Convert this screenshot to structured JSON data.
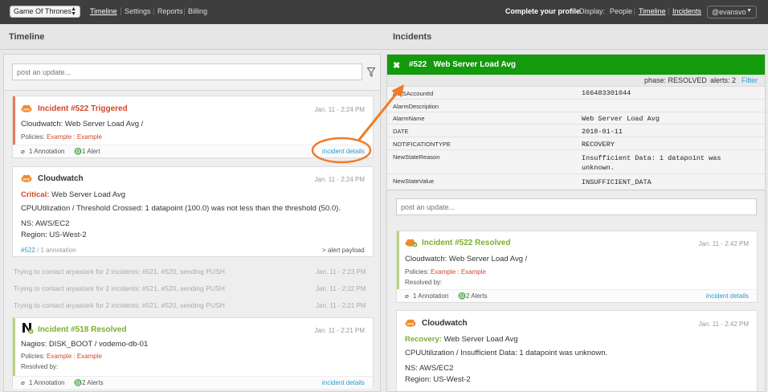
{
  "topbar": {
    "project": "Game Of Thrones",
    "nav": [
      "Timeline",
      "Settings",
      "Reports",
      "Billing"
    ],
    "complete_profile": "Complete your profile",
    "display_label": "Display:",
    "display_options": [
      "People",
      "Timeline",
      "Incidents"
    ],
    "user": "@evansvo"
  },
  "left": {
    "header": "Timeline",
    "post_placeholder": "post an update...",
    "card1": {
      "title": "Incident #522 Triggered",
      "time": "Jan. 11 - 2:24 PM",
      "body": "Cloudwatch: Web Server Load Avg /",
      "policies_label": "Policies:",
      "policies_value": "Example : Example",
      "annotation": "1 Annotation",
      "alerts": "1 Alert",
      "details": "incident details"
    },
    "card2": {
      "title": "Cloudwatch",
      "time": "Jan. 11 - 2:24 PM",
      "critical_label": "Critical:",
      "critical_value": "Web Server Load Avg",
      "desc": "CPUUtilization / Threshold Crossed: 1 datapoint (100.0) was not less than the threshold (50.0).",
      "ns": "NS: AWS/EC2",
      "region": "Region: US-West-2",
      "link": "#522",
      "annotation": "/ 1 annotation",
      "payload": "> alert payload"
    },
    "logs": [
      {
        "text": "Trying to contact aryastark for 2 incidents: #521, #520, sending PUSH",
        "time": "Jan. 11 - 2:23 PM"
      },
      {
        "text": "Trying to contact aryastark for 2 incidents: #521, #520, sending PUSH",
        "time": "Jan. 11 - 2:22 PM"
      },
      {
        "text": "Trying to contact aryastark for 2 incidents: #521, #520, sending PUSH",
        "time": "Jan. 11 - 2:21 PM"
      }
    ],
    "card3": {
      "title": "Incident #518 Resolved",
      "time": "Jan. 11 - 2:21 PM",
      "body": "Nagios: DISK_BOOT / vodemo-db-01",
      "policies_label": "Policies:",
      "policies_value": "Example : Example",
      "resolved_by": "Resolved by:",
      "annotation": "1 Annotation",
      "alerts": "2 Alerts",
      "details": "incident details"
    }
  },
  "right": {
    "header": "Incidents",
    "incident_title": "#522   Web Server Load Avg",
    "phase": "phase: RESOLVED",
    "alerts": "alerts: 2",
    "filter": "Filter",
    "fields": [
      {
        "key": "AWSAccountId",
        "value": "166483301044"
      },
      {
        "key": "AlarmDescription",
        "value": ""
      },
      {
        "key": "AlarmName",
        "value": "Web Server Load Avg"
      },
      {
        "key": "DATE",
        "value": "2018-01-11"
      },
      {
        "key": "NOTIFICATIONTYPE",
        "value": "RECOVERY"
      },
      {
        "key": "NewStateReason",
        "value": "Insufficient Data: 1 datapoint was"
      },
      {
        "key": "NewStateValue",
        "value": "INSUFFICIENT_DATA"
      }
    ],
    "reason_cont": "unknown.",
    "post_placeholder": "post an update...",
    "card1": {
      "title": "Incident #522 Resolved",
      "time": "Jan. 11 - 2:42 PM",
      "body": "Cloudwatch: Web Server Load Avg /",
      "policies_label": "Policies:",
      "policies_value": "Example : Example",
      "resolved_by": "Resolved by:",
      "annotation": "1 Annotation",
      "alerts": "2 Alerts",
      "details": "incident details"
    },
    "card2": {
      "title": "Cloudwatch",
      "time": "Jan. 11 - 2:42 PM",
      "recovery_label": "Recovery:",
      "recovery_value": "Web Server Load Avg",
      "desc": "CPUUtilization / Insufficient Data: 1 datapoint was unknown.",
      "ns": "NS: AWS/EC2",
      "region": "Region: US-West-2"
    }
  },
  "colors": {
    "topbar": "#3e3e3e",
    "incident_green": "#139a0d",
    "triggered_red": "#d5472b",
    "resolved_green": "#7ab02f",
    "link_blue": "#2b9ad0",
    "annotation_orange": "#f07b2a"
  }
}
